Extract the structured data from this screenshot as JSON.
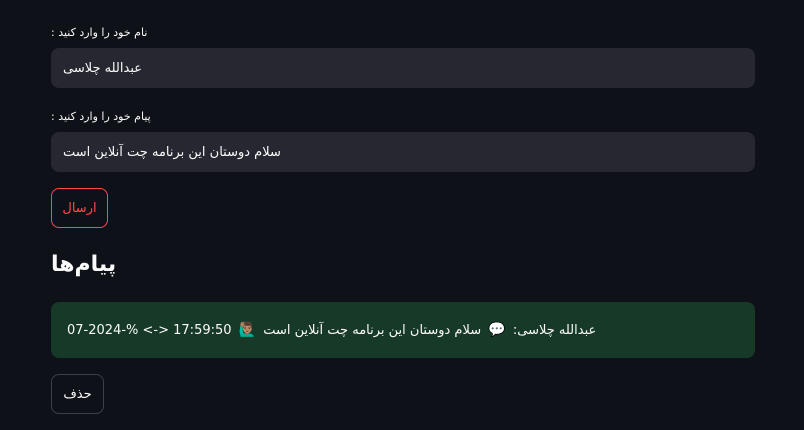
{
  "form": {
    "name_label": "نام خود را وارد کنید :",
    "name_value": "عبدالله چلاسی",
    "message_label": "پیام خود را وارد کنید :",
    "message_value": "سلام دوستان این برنامه چت آنلاین است",
    "send_button": "ارسال"
  },
  "messages_section": {
    "heading": "پیام‌ها",
    "items": [
      {
        "author": "عبدالله چلاسی:",
        "text": "سلام دوستان این برنامه چت آنلاین است",
        "timestamp": "17:59:50 <-> %-2024-07",
        "icons": [
          "speech-bubble-icon",
          "person-raising-hand-icon"
        ]
      }
    ]
  },
  "delete_button": "حذف",
  "colors": {
    "background": "#0e1117",
    "input_bg": "#262730",
    "primary_red": "#ff4b4b",
    "message_bg": "#173928"
  }
}
